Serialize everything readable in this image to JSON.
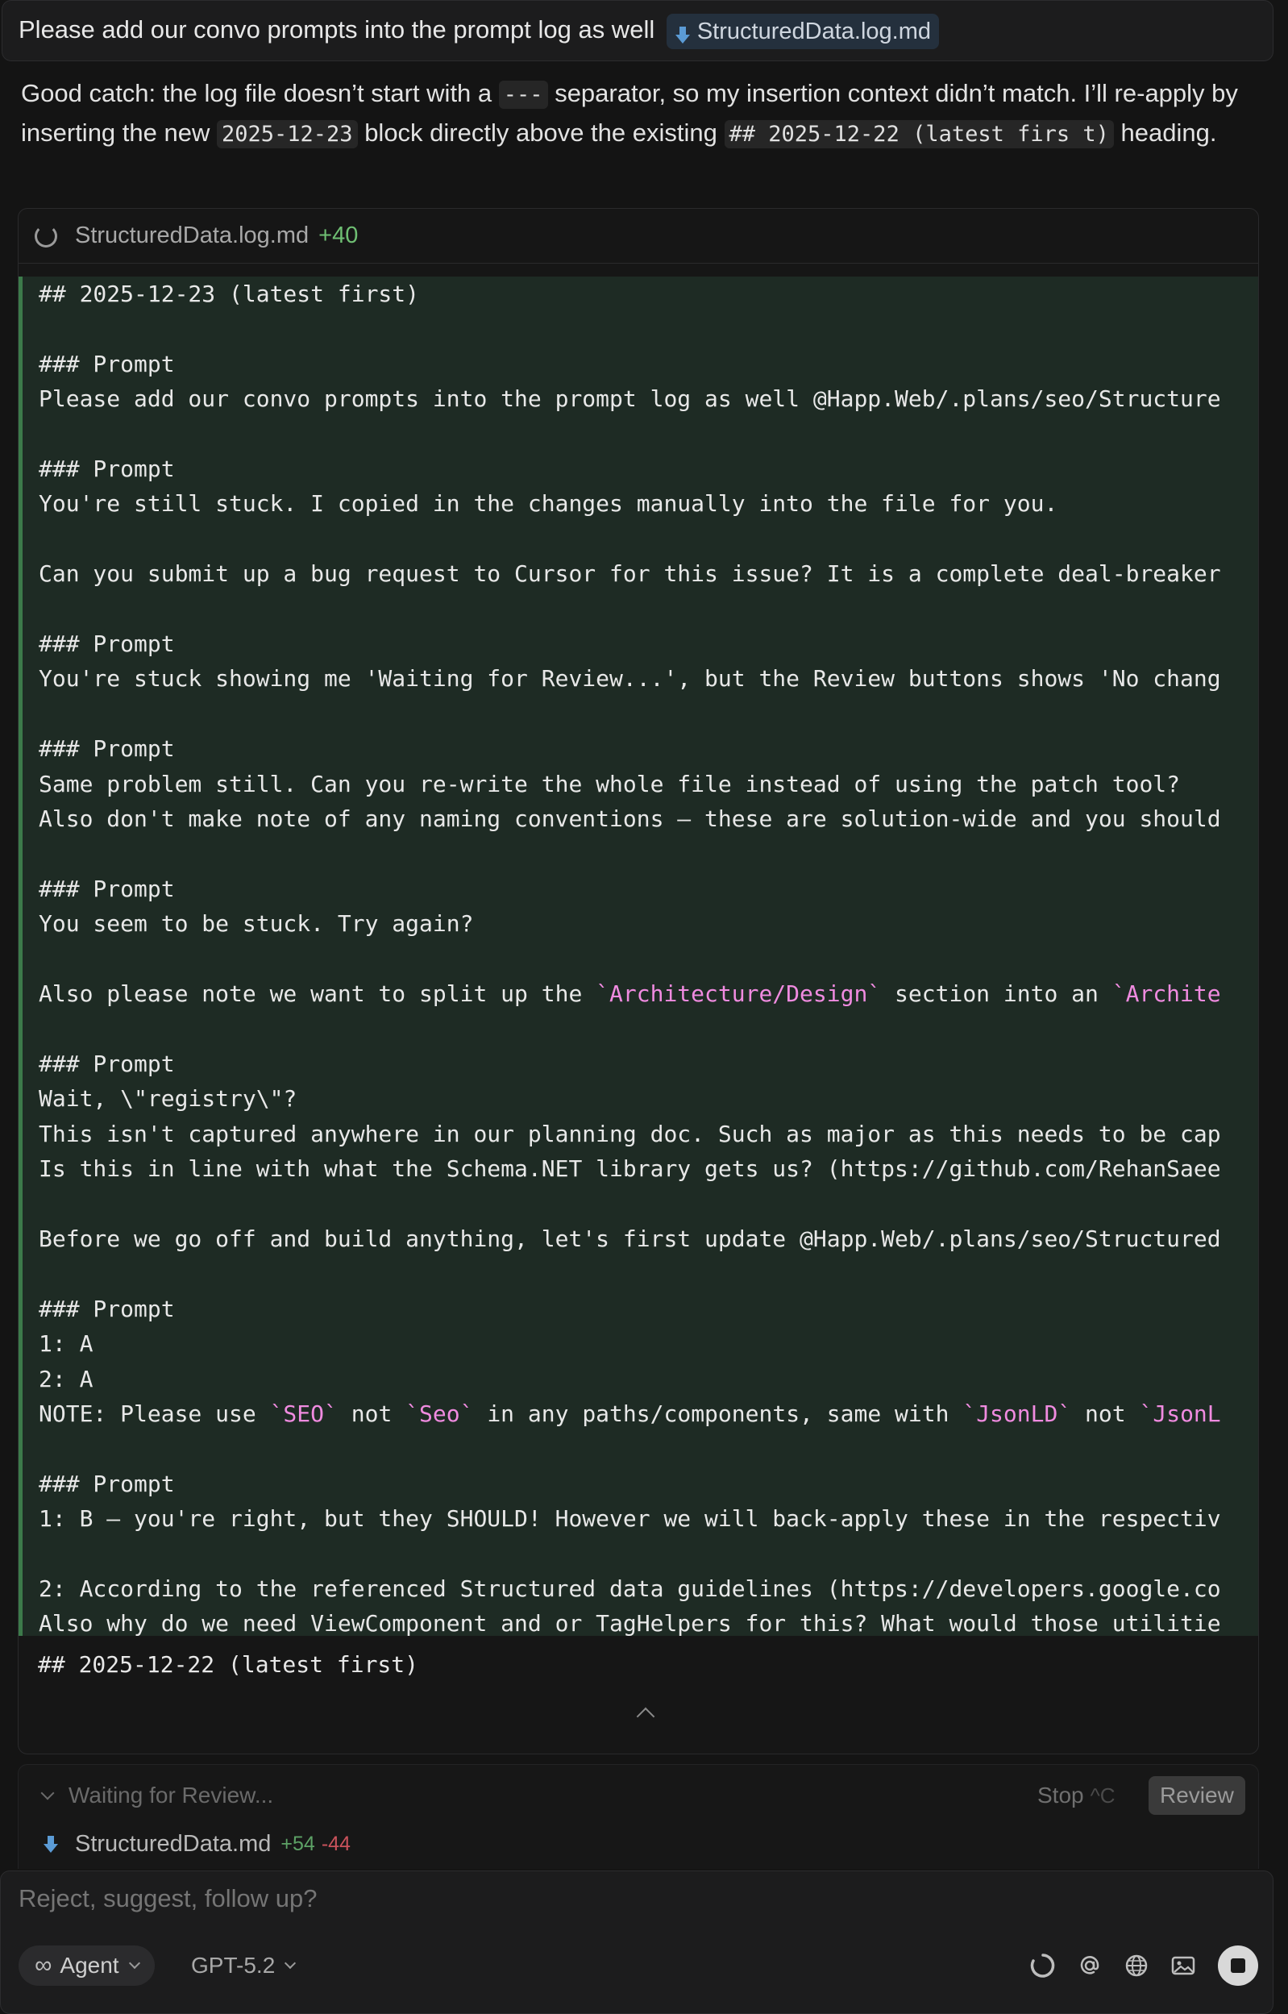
{
  "user_message": {
    "text": "Please add our convo prompts into the prompt log as well",
    "file_chip": "StructuredData.log.md"
  },
  "assistant": {
    "p1": "Good catch: the log file doesn’t start with a",
    "c1": "---",
    "p2": "separator, so my insertion context didn’t match. I’ll re-apply by inserting the new",
    "c2": "2025-12-23",
    "p3": "block directly above the existing",
    "c3": "## 2025-12-22 (latest firs t)",
    "p4": "heading."
  },
  "diff": {
    "filename": "StructuredData.log.md",
    "added": "+40",
    "lines": [
      [
        {
          "t": "## 2025-12-23 (latest first)"
        }
      ],
      [
        {
          "t": ""
        }
      ],
      [
        {
          "t": "### Prompt"
        }
      ],
      [
        {
          "t": "Please add our convo prompts into the prompt log as well @Happ.Web/.plans/seo/Structure"
        }
      ],
      [
        {
          "t": ""
        }
      ],
      [
        {
          "t": "### Prompt"
        }
      ],
      [
        {
          "t": "You're still stuck. I copied in the changes manually into the file for you."
        }
      ],
      [
        {
          "t": ""
        }
      ],
      [
        {
          "t": "Can you submit up a bug request to Cursor for this issue? It is a complete deal-breaker"
        }
      ],
      [
        {
          "t": ""
        }
      ],
      [
        {
          "t": "### Prompt"
        }
      ],
      [
        {
          "t": "You're stuck showing me 'Waiting for Review...', but the Review buttons shows 'No chang"
        }
      ],
      [
        {
          "t": ""
        }
      ],
      [
        {
          "t": "### Prompt"
        }
      ],
      [
        {
          "t": "Same problem still. Can you re-write the whole file instead of using the patch tool?"
        }
      ],
      [
        {
          "t": "Also don't make note of any naming conventions — these are solution-wide and you should"
        }
      ],
      [
        {
          "t": ""
        }
      ],
      [
        {
          "t": "### Prompt"
        }
      ],
      [
        {
          "t": "You seem to be stuck. Try again?"
        }
      ],
      [
        {
          "t": ""
        }
      ],
      [
        {
          "t": "Also please note we want to split up the "
        },
        {
          "t": "`Architecture/Design`",
          "h": true
        },
        {
          "t": " section into an "
        },
        {
          "t": "`Archite",
          "h": true
        }
      ],
      [
        {
          "t": ""
        }
      ],
      [
        {
          "t": "### Prompt"
        }
      ],
      [
        {
          "t": "Wait, \\\"registry\\\"?"
        }
      ],
      [
        {
          "t": "This isn't captured anywhere in our planning doc. Such as major as this needs to be cap"
        }
      ],
      [
        {
          "t": "Is this in line with what the Schema.NET library gets us? (https://github.com/RehanSaee"
        }
      ],
      [
        {
          "t": ""
        }
      ],
      [
        {
          "t": "Before we go off and build anything, let's first update @Happ.Web/.plans/seo/Structured"
        }
      ],
      [
        {
          "t": ""
        }
      ],
      [
        {
          "t": "### Prompt"
        }
      ],
      [
        {
          "t": "1: A"
        }
      ],
      [
        {
          "t": "2: A"
        }
      ],
      [
        {
          "t": "NOTE: Please use "
        },
        {
          "t": "`SEO`",
          "h": true
        },
        {
          "t": " not "
        },
        {
          "t": "`Seo`",
          "h": true
        },
        {
          "t": " in any paths/components, same with "
        },
        {
          "t": "`JsonLD`",
          "h": true
        },
        {
          "t": " not "
        },
        {
          "t": "`JsonL",
          "h": true
        }
      ],
      [
        {
          "t": ""
        }
      ],
      [
        {
          "t": "### Prompt"
        }
      ],
      [
        {
          "t": "1: B — you're right, but they SHOULD! However we will back-apply these in the respectiv"
        }
      ],
      [
        {
          "t": ""
        }
      ],
      [
        {
          "t": "2: According to the referenced Structured data guidelines (https://developers.google.co"
        }
      ],
      [
        {
          "t": "Also why do we need ViewComponent and or TagHelpers for this? What would those utilitie"
        }
      ]
    ],
    "context_line": "## 2025-12-22 (latest first)"
  },
  "review": {
    "status": "Waiting for Review...",
    "stop_label": "Stop",
    "stop_shortcut": "^C",
    "review_label": "Review",
    "file": "StructuredData.md",
    "additions": "+54",
    "deletions": "-44"
  },
  "composer": {
    "placeholder": "Reject, suggest, follow up?",
    "mode": "Agent",
    "model": "GPT-5.2"
  },
  "icons": [
    "markdown-file-icon",
    "spinner-icon",
    "chevron-up-icon",
    "chevron-down-icon",
    "infinity-icon",
    "loading-icon",
    "at-icon",
    "globe-icon",
    "image-icon",
    "stop-icon"
  ],
  "colors": {
    "added_bg": "#1e2b24",
    "added_bar": "#3c7a4a",
    "highlight": "#f08be0",
    "additions": "#5da266",
    "deletions": "#c9525b"
  }
}
